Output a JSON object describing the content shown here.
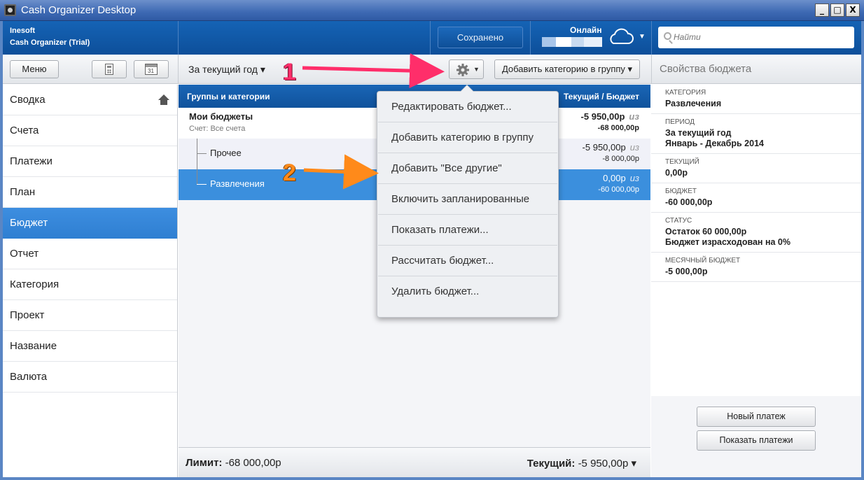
{
  "window": {
    "title": "Cash Organizer Desktop",
    "minimize": "_",
    "maximize": "□",
    "close": "X"
  },
  "header": {
    "company": "Inesoft",
    "product": "Cash Organizer (Trial)",
    "saved_label": "Сохранено",
    "online_label": "Онлайн",
    "search_placeholder": "Найти"
  },
  "toolbar": {
    "menu_label": "Меню",
    "period_label": "За текущий год ▾",
    "add_category_label": "Добавить категорию в группу ▾",
    "props_title": "Свойства бюджета",
    "calendar_day": "31"
  },
  "sidebar": {
    "items": [
      {
        "label": "Сводка"
      },
      {
        "label": "Счета"
      },
      {
        "label": "Платежи"
      },
      {
        "label": "План"
      },
      {
        "label": "Бюджет"
      },
      {
        "label": "Отчет"
      },
      {
        "label": "Категория"
      },
      {
        "label": "Проект"
      },
      {
        "label": "Название"
      },
      {
        "label": "Валюта"
      }
    ],
    "active_index": 4
  },
  "budget": {
    "col_groups": "Группы и категории",
    "col_current": "Текущий / Бюджет",
    "rows": [
      {
        "name": "Мои бюджеты",
        "sub": "Счет: Все счета",
        "current": "-5 950,00р",
        "of": "из",
        "budget": "-68 000,00р"
      },
      {
        "name": "Прочее",
        "current": "-5 950,00р",
        "of": "из",
        "budget": "-8 000,00р"
      },
      {
        "name": "Развлечения",
        "current": "0,00р",
        "of": "из",
        "budget": "-60 000,00р"
      }
    ],
    "footer": {
      "limit_label": "Лимит:",
      "limit_value": "-68 000,00р",
      "current_label": "Текущий:",
      "current_value": "-5 950,00р ▾"
    }
  },
  "menu": {
    "items": [
      {
        "label": "Редактировать бюджет..."
      },
      {
        "label": "Добавить категорию в группу"
      },
      {
        "label": "Добавить \"Все другие\""
      },
      {
        "label": "Включить запланированные"
      },
      {
        "label": "Показать платежи..."
      },
      {
        "label": "Рассчитать бюджет..."
      },
      {
        "label": "Удалить бюджет..."
      }
    ]
  },
  "properties": {
    "items": [
      {
        "key": "Категория",
        "value": "Развлечения"
      },
      {
        "key": "Период",
        "value": "За текущий год",
        "value2": "Январь - Декабрь 2014"
      },
      {
        "key": "Текущий",
        "value": "0,00р"
      },
      {
        "key": "Бюджет",
        "value": "-60 000,00р"
      },
      {
        "key": "Статус",
        "value": "Остаток 60 000,00р",
        "value2": "Бюджет израсходован на 0%"
      },
      {
        "key": "Месячный бюджет",
        "value": "-5 000,00р"
      }
    ],
    "new_payment": "Новый платеж",
    "show_payments": "Показать платежи"
  },
  "annotations": {
    "step1": "1",
    "step2": "2",
    "step1_color": "#ff2e6a",
    "step2_color": "#ff8a1a"
  },
  "colors": {
    "accent_blue": "#1563b5",
    "selected_row": "#3d8ee0"
  }
}
